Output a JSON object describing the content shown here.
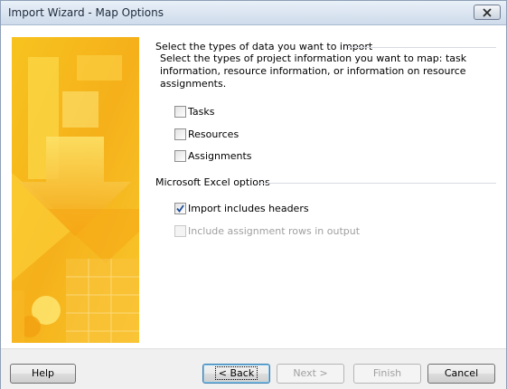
{
  "window": {
    "title": "Import Wizard - Map Options"
  },
  "sections": {
    "types": {
      "heading": "Select the types of data you want to import",
      "description": "Select the types of project information you want to map: task information, resource information, or information on resource assignments.",
      "options": [
        {
          "label": "Tasks",
          "checked": false
        },
        {
          "label": "Resources",
          "checked": false
        },
        {
          "label": "Assignments",
          "checked": false
        }
      ]
    },
    "excel": {
      "heading": "Microsoft Excel options",
      "options": [
        {
          "label": "Import includes headers",
          "checked": true,
          "enabled": true
        },
        {
          "label": "Include assignment rows in output",
          "checked": false,
          "enabled": false
        }
      ]
    }
  },
  "buttons": {
    "help": "Help",
    "back": "< Back",
    "next": "Next >",
    "finish": "Finish",
    "cancel": "Cancel"
  },
  "colors": {
    "banner_primary": "#f6b21a",
    "banner_light": "#fde36a",
    "accent_check": "#1f4f9a"
  }
}
